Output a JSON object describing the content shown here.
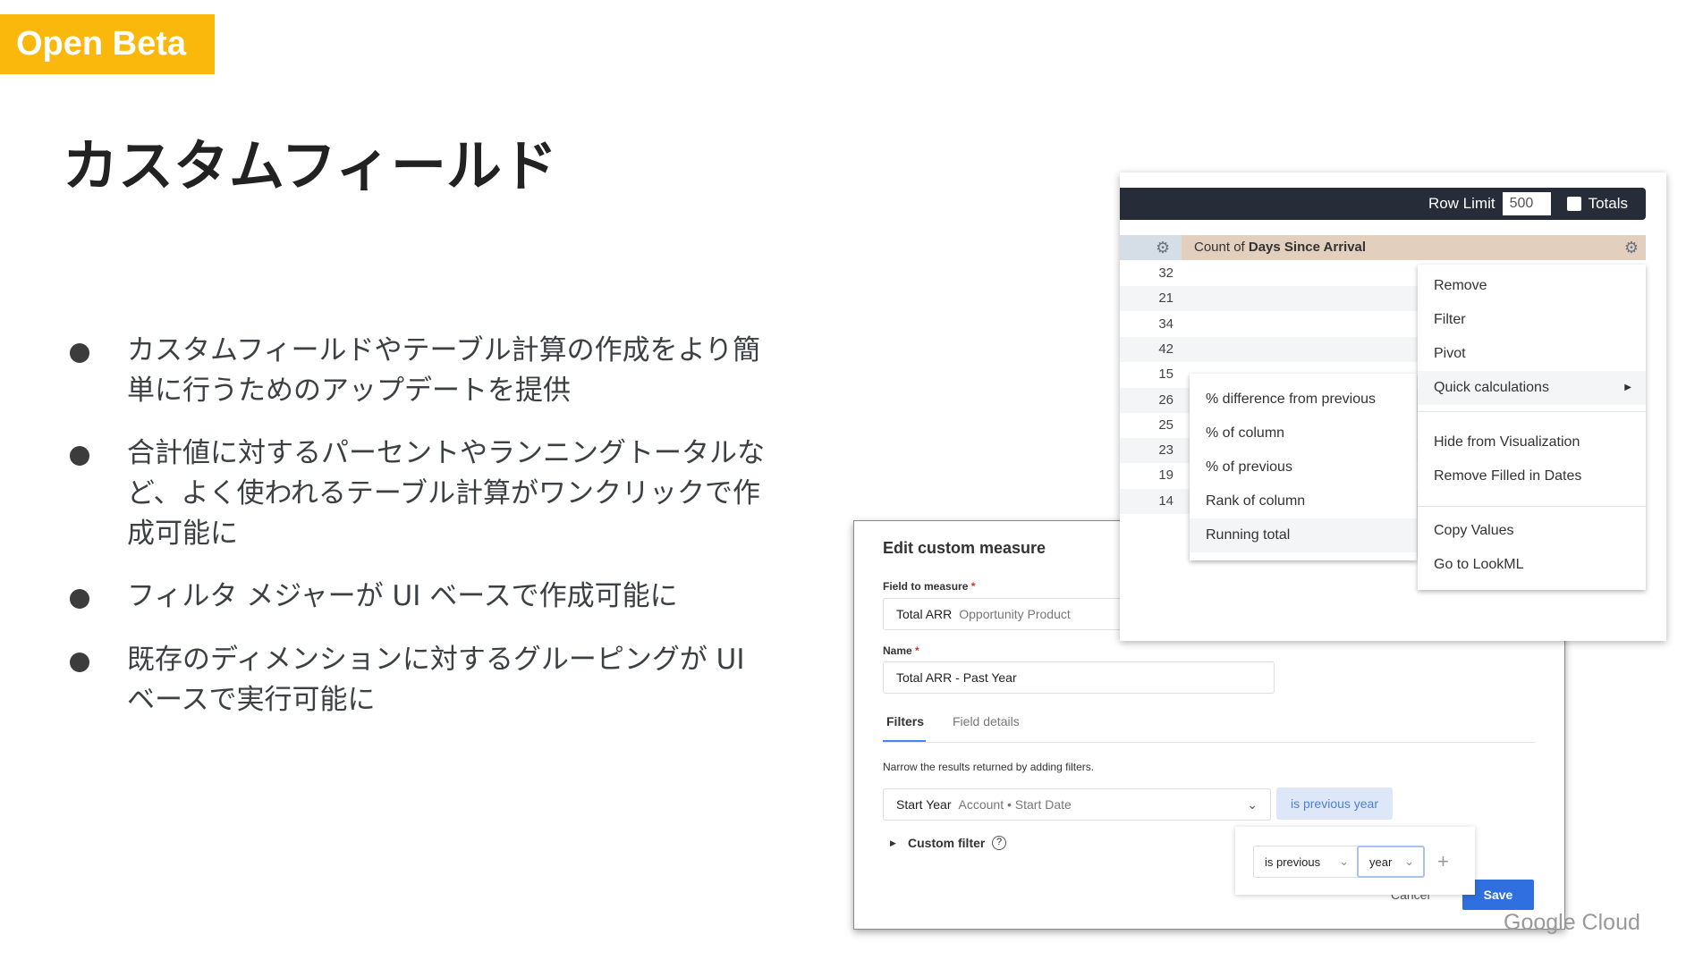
{
  "badge": "Open Beta",
  "title": "カスタムフィールド",
  "bullets": [
    "カスタムフィールドやテーブル計算の作成をより簡単に行うためのアップデートを提供",
    "合計値に対するパーセントやランニングトータルなど、よく使われるテーブル計算がワンクリックで作成可能に",
    "フィルタ メジャーが UI ベースで作成可能に",
    "既存のディメンションに対するグルーピングが UI ベースで実行可能に"
  ],
  "table": {
    "row_limit_label": "Row Limit",
    "row_limit_value": "500",
    "totals_label": "Totals",
    "header_prefix": "Count of ",
    "header_field": "Days Since Arrival",
    "rows": [
      "32",
      "21",
      "34",
      "42",
      "15",
      "26",
      "25",
      "23",
      "19",
      "14"
    ]
  },
  "menu": {
    "items": [
      "Remove",
      "Filter",
      "Pivot",
      "Quick calculations",
      "Hide from Visualization",
      "Remove Filled in Dates",
      "Copy Values",
      "Go to LookML"
    ]
  },
  "submenu": {
    "items": [
      "% difference from previous",
      "% of column",
      "% of previous",
      "Rank of column",
      "Running total"
    ]
  },
  "dialog": {
    "title": "Edit custom measure",
    "field_label": "Field to measure",
    "field_value": "Total ARR",
    "field_sub": "Opportunity Product",
    "name_label": "Name",
    "name_value": "Total ARR - Past Year",
    "tabs": [
      "Filters",
      "Field details"
    ],
    "hint": "Narrow the results returned by adding filters.",
    "filter_field": "Start Year",
    "filter_sub": "Account • Start Date",
    "filter_value": "is previous year",
    "custom_filter": "Custom filter",
    "op": "is previous",
    "unit": "year",
    "cancel": "Cancel",
    "save": "Save"
  },
  "footer_logo": "Google Cloud"
}
